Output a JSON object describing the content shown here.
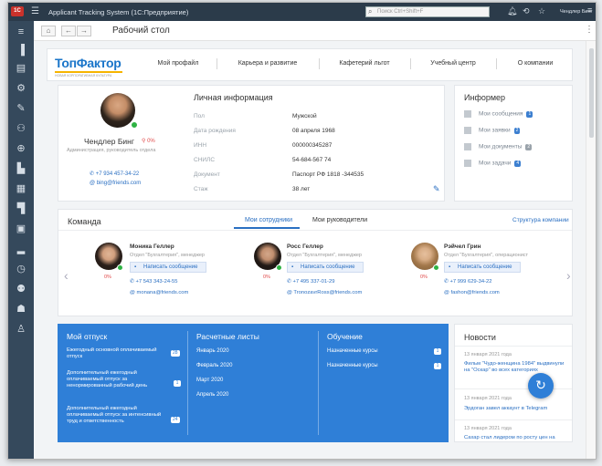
{
  "app": {
    "logo": "1С",
    "title": "Applicant Tracking System  (1С:Предприятие)",
    "search_placeholder": "Поиск Ctrl+Shift+F",
    "user": "Чендлер Бинг"
  },
  "toolbar": {
    "title": "Рабочий стол"
  },
  "brand": {
    "name": "ТопФактор",
    "tagline": "НОВАЯ КОРПОРАТИВНАЯ КУЛЬТУРА"
  },
  "top_nav": [
    "Мой профайл",
    "Карьера и развитие",
    "Кафетерий льгот",
    "Учебный центр",
    "О компании"
  ],
  "profile": {
    "name": "Чендлер Бинг",
    "percent": "0%",
    "position": "Администрация, руководитель отдела",
    "phone": "+7 934 457-34-22",
    "email": "bing@friends.com"
  },
  "personal": {
    "heading": "Личная информация",
    "rows": [
      {
        "label": "Пол",
        "value": "Мужской"
      },
      {
        "label": "Дата рождения",
        "value": "08 апреля 1968"
      },
      {
        "label": "ИНН",
        "value": "000000345287"
      },
      {
        "label": "СНИЛС",
        "value": "54-684-567 74"
      },
      {
        "label": "Документ",
        "value": "Паспорт РФ 1818 -344535"
      },
      {
        "label": "Стаж",
        "value": "38 лет"
      }
    ]
  },
  "informer": {
    "heading": "Информер",
    "items": [
      {
        "label": "Мои сообщения",
        "count": "1"
      },
      {
        "label": "Мои заявки",
        "count": "2"
      },
      {
        "label": "Мои документы",
        "count": "2"
      },
      {
        "label": "Мои задачи",
        "count": "4"
      }
    ]
  },
  "team": {
    "heading": "Команда",
    "tabs": [
      "Мои сотрудники",
      "Мои руководители"
    ],
    "structure_link": "Структура компании",
    "members": [
      {
        "name": "Моника Геллер",
        "dept": "Отдел \"Бухгалтерия\", менеджер",
        "button": "Написать сообщение",
        "percent": "0%",
        "phone": "+7 543 343-24-55",
        "email": "monana@friends.com"
      },
      {
        "name": "Росс Геллер",
        "dept": "Отдел \"Бухгалтерия\", менеджер",
        "button": "Написать сообщение",
        "percent": "0%",
        "phone": "+7 495 337-01-29",
        "email": "TronozavrRoss@friends.com"
      },
      {
        "name": "Рэйчел Грин",
        "dept": "Отдел \"Бухгалтерия\", операционист",
        "button": "Написать сообщение",
        "percent": "0%",
        "phone": "+7 999 629-34-22",
        "email": "fashon@friends.com"
      }
    ]
  },
  "vacation": {
    "heading": "Мой отпуск",
    "items": [
      {
        "label": "Ежегодный основной оплачиваемый отпуск",
        "count": "28"
      },
      {
        "label": "Дополнительный ежегодный оплачиваемый отпуск за ненормированный рабочий день",
        "count": "1"
      },
      {
        "label": "Дополнительный ежегодный оплачиваемый отпуск за интенсивный труд и ответственность",
        "count": "24"
      }
    ]
  },
  "payslips": {
    "heading": "Расчетные листы",
    "items": [
      "Январь 2020",
      "Февраль 2020",
      "Март 2020",
      "Апрель 2020"
    ]
  },
  "training": {
    "heading": "Обучение",
    "items": [
      {
        "label": "Назначенные курсы",
        "count": "1"
      },
      {
        "label": "Назначенные курсы",
        "count": "1"
      }
    ]
  },
  "news": {
    "heading": "Новости",
    "items": [
      {
        "date": "13 января 2021 года",
        "title": "Фильм \"Чудо-женщина 1984\" выдвинули на \"Оскар\" во всех категориях"
      },
      {
        "date": "13 января 2021 года",
        "title": "Эрдоган завел аккаунт в Telegram"
      },
      {
        "date": "13 января 2021 года",
        "title": "Сахар стал лидером по росту цен на продукты в РФ в 2020 году"
      }
    ]
  },
  "colors": {
    "accent": "#2f7fd7",
    "sidebar": "#35495c",
    "titlebar": "#2b3b4a",
    "online": "#2fb344"
  }
}
